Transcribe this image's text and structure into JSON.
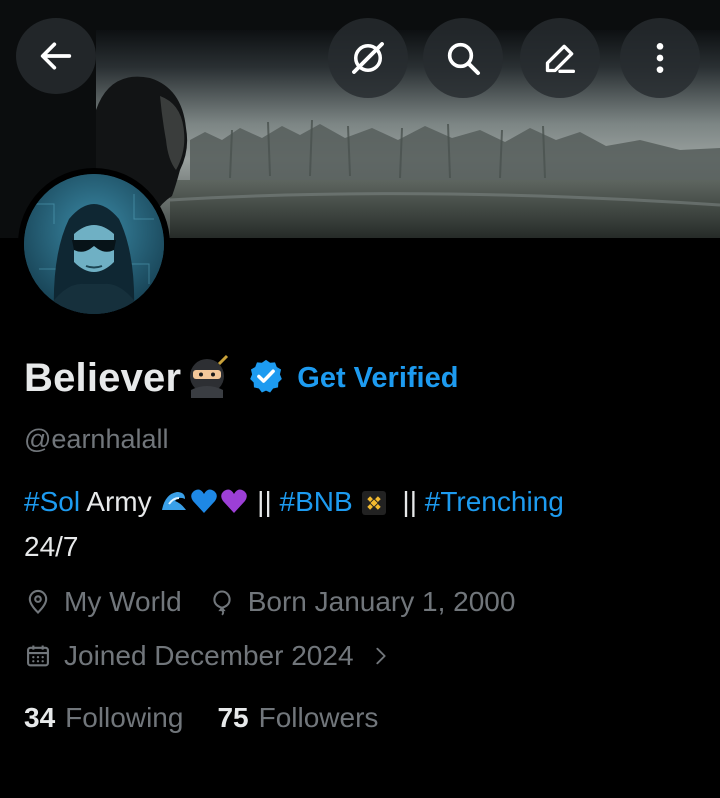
{
  "profile": {
    "display_name": "Believer",
    "name_emoji": "ninja-emoji",
    "verified_badge": "verified-badge-icon",
    "get_verified_label": "Get Verified",
    "handle": "@earnhalall",
    "bio": {
      "tag_sol": "#Sol",
      "army": " Army ",
      "sep1": "  || ",
      "tag_bnb": "#BNB",
      "sep2": "  || ",
      "tag_trenching": "#Trenching",
      "line2": "24/7"
    },
    "location": "My World",
    "birthday": "Born January 1, 2000",
    "joined": "Joined December 2024",
    "following_count": "34",
    "following_label": "Following",
    "followers_count": "75",
    "followers_label": "Followers"
  },
  "toolbar": {
    "back": "back-arrow-icon",
    "grok": "grok-icon",
    "search": "search-icon",
    "edit": "edit-pencil-icon",
    "more": "more-vertical-icon"
  },
  "colors": {
    "background": "#000000",
    "text": "#e7e9ea",
    "muted": "#71767b",
    "accent": "#1d9bf0"
  }
}
